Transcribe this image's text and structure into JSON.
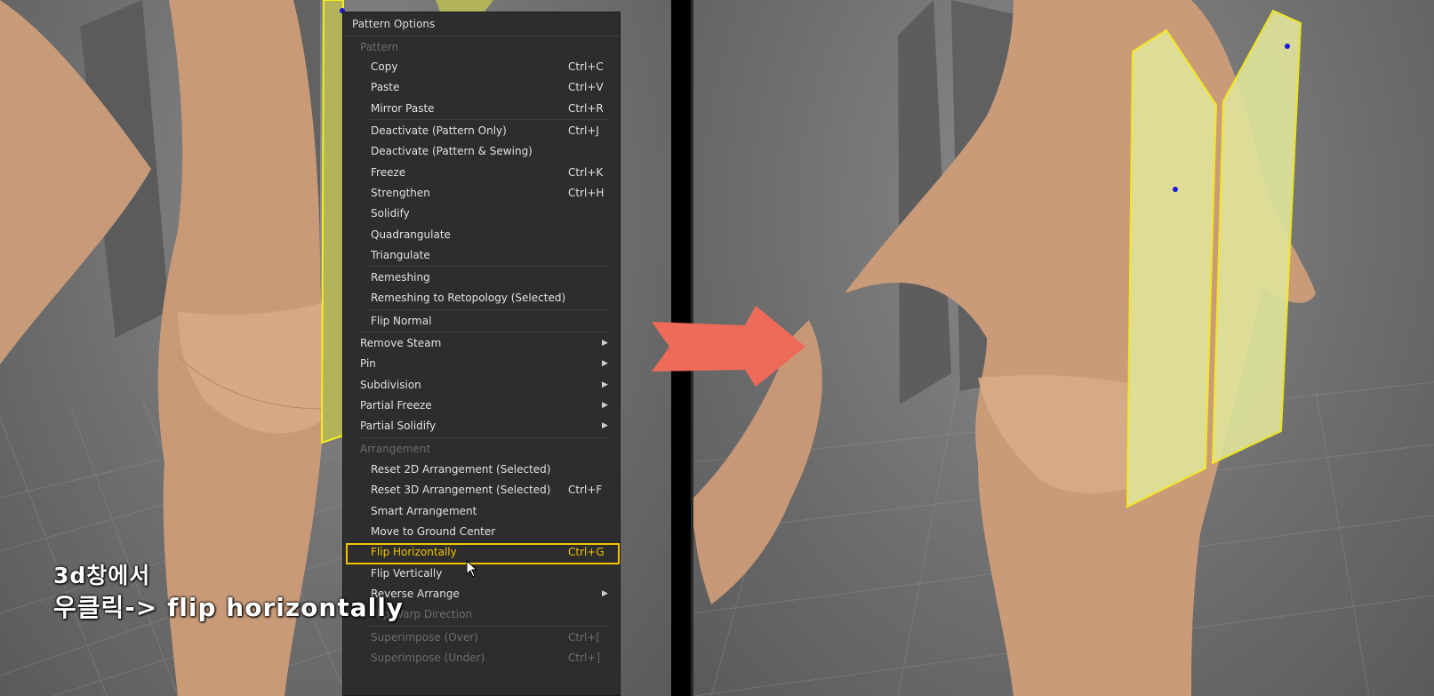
{
  "menu": {
    "title": "Pattern Options",
    "sections": {
      "pattern": "Pattern",
      "arrangement": "Arrangement"
    },
    "items": {
      "copy": {
        "label": "Copy",
        "shortcut": "Ctrl+C"
      },
      "paste": {
        "label": "Paste",
        "shortcut": "Ctrl+V"
      },
      "mirror_paste": {
        "label": "Mirror Paste",
        "shortcut": "Ctrl+R"
      },
      "deactivate_pattern": {
        "label": "Deactivate (Pattern Only)",
        "shortcut": "Ctrl+J"
      },
      "deactivate_sewing": {
        "label": "Deactivate (Pattern & Sewing)"
      },
      "freeze": {
        "label": "Freeze",
        "shortcut": "Ctrl+K"
      },
      "strengthen": {
        "label": "Strengthen",
        "shortcut": "Ctrl+H"
      },
      "solidify": {
        "label": "Solidify"
      },
      "quadrangulate": {
        "label": "Quadrangulate"
      },
      "triangulate": {
        "label": "Triangulate"
      },
      "remeshing": {
        "label": "Remeshing"
      },
      "remeshing_retopo": {
        "label": "Remeshing to Retopology (Selected)"
      },
      "flip_normal": {
        "label": "Flip Normal"
      },
      "remove_steam": {
        "label": "Remove Steam"
      },
      "pin": {
        "label": "Pin"
      },
      "subdivision": {
        "label": "Subdivision"
      },
      "partial_freeze": {
        "label": "Partial Freeze"
      },
      "partial_solidify": {
        "label": "Partial Solidify"
      },
      "reset_2d": {
        "label": "Reset 2D Arrangement (Selected)"
      },
      "reset_3d": {
        "label": "Reset 3D Arrangement (Selected)",
        "shortcut": "Ctrl+F"
      },
      "smart_arrangement": {
        "label": "Smart Arrangement"
      },
      "move_ground": {
        "label": "Move to Ground Center"
      },
      "flip_horizontally": {
        "label": "Flip Horizontally",
        "shortcut": "Ctrl+G"
      },
      "flip_vertically": {
        "label": "Flip Vertically"
      },
      "reverse_arrangement": {
        "label": "Reverse Arrange"
      },
      "flip_warp": {
        "label": "Flip Warp Direction"
      },
      "superimpose_over": {
        "label": "Superimpose (Over)",
        "shortcut": "Ctrl+["
      },
      "superimpose_under": {
        "label": "Superimpose (Under)",
        "shortcut": "Ctrl+]"
      }
    },
    "highlight_color": "#f2c400"
  },
  "caption": {
    "line1": "3d창에서",
    "line2": "우클릭-> flip horizontally"
  },
  "colors": {
    "arrow": "#ee6b5a",
    "pattern_fill": "#dfe39a",
    "pattern_outline": "#f5ee1c",
    "skin": "#c99a78"
  },
  "icons": {
    "submenu": "right-triangle",
    "cursor": "mouse-pointer"
  }
}
